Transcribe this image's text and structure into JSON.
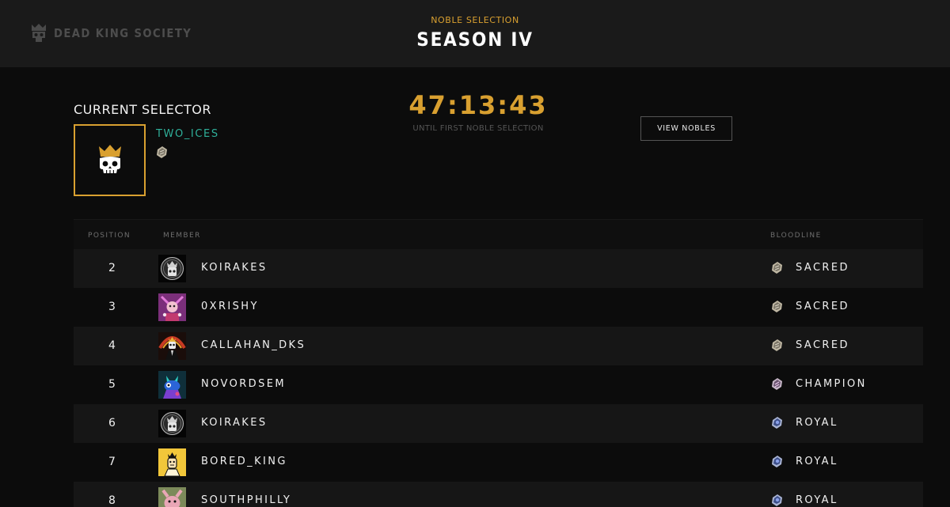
{
  "brand": {
    "name": "DEAD KING SOCIETY"
  },
  "header": {
    "subtitle": "NOBLE SELECTION",
    "title": "SEASON IV"
  },
  "selector": {
    "label": "CURRENT SELECTOR",
    "username": "TWO_ICES",
    "bloodline_icon": "sacred-stone-icon"
  },
  "countdown": {
    "time": "47:13:43",
    "caption": "UNTIL FIRST NOBLE SELECTION"
  },
  "actions": {
    "view_nobles": "VIEW NOBLES"
  },
  "colors": {
    "accent": "#d9a030",
    "username": "#2fb09a",
    "background": "#0c0c0c",
    "header": "#1a1a1a"
  },
  "table": {
    "columns": {
      "position": "POSITION",
      "member": "MEMBER",
      "bloodline": "BLOODLINE"
    },
    "rows": [
      {
        "position": "2",
        "member": "KOIRAKES",
        "bloodline": "SACRED",
        "avatar": "skull-coin-avatar",
        "bloodline_icon": "sacred-stone-icon"
      },
      {
        "position": "3",
        "member": "0XRISHY",
        "bloodline": "SACRED",
        "avatar": "purple-jester-avatar",
        "bloodline_icon": "sacred-stone-icon"
      },
      {
        "position": "4",
        "member": "CALLAHAN_DKS",
        "bloodline": "SACRED",
        "avatar": "skeleton-king-avatar",
        "bloodline_icon": "sacred-stone-icon"
      },
      {
        "position": "5",
        "member": "NOVORDSEM",
        "bloodline": "CHAMPION",
        "avatar": "blue-creature-avatar",
        "bloodline_icon": "champion-stone-icon"
      },
      {
        "position": "6",
        "member": "KOIRAKES",
        "bloodline": "ROYAL",
        "avatar": "skull-coin-avatar",
        "bloodline_icon": "royal-stone-icon"
      },
      {
        "position": "7",
        "member": "BORED_KING",
        "bloodline": "ROYAL",
        "avatar": "yellow-king-avatar",
        "bloodline_icon": "royal-stone-icon"
      },
      {
        "position": "8",
        "member": "SOUTHPHILLY",
        "bloodline": "ROYAL",
        "avatar": "pink-creature-avatar",
        "bloodline_icon": "royal-stone-icon"
      }
    ]
  }
}
